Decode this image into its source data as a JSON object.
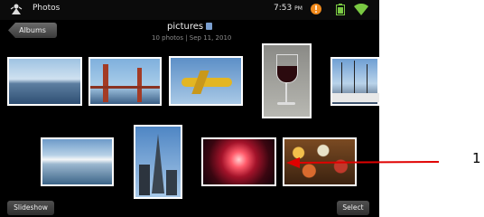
{
  "statusbar": {
    "app_title": "Photos",
    "time": "7:53",
    "ampm": "PM"
  },
  "header": {
    "back_label": "Albums",
    "folder_title": "pictures",
    "folder_subtitle": "10 photos | Sep 11, 2010"
  },
  "footer": {
    "slideshow_label": "Slideshow",
    "select_label": "Select"
  },
  "annotation": {
    "label": "1"
  },
  "photos": [
    {
      "name": "harbor-city"
    },
    {
      "name": "golden-gate-bridge"
    },
    {
      "name": "airplane"
    },
    {
      "name": "wine-glass"
    },
    {
      "name": "sailboats"
    },
    {
      "name": "snowy-lake"
    },
    {
      "name": "skyscraper"
    },
    {
      "name": "fireworks"
    },
    {
      "name": "food-tray"
    }
  ]
}
